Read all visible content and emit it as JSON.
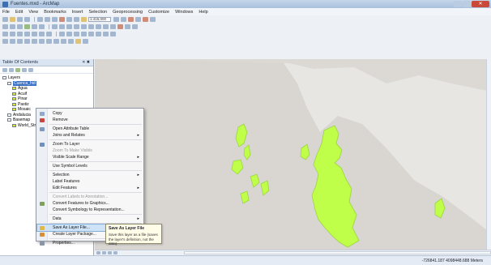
{
  "window": {
    "title": "Fuentes.mxd - ArcMap"
  },
  "menu": [
    "File",
    "Edit",
    "View",
    "Bookmarks",
    "Insert",
    "Selection",
    "Geoprocessing",
    "Customize",
    "Windows",
    "Help"
  ],
  "toolbar": {
    "scale": "1:415,000"
  },
  "toc": {
    "title": "Table Of Contents",
    "pin": "✕ ✖",
    "items": [
      {
        "label": "Layers",
        "indent": 0
      },
      {
        "label": "Cuenca_hid",
        "indent": 1,
        "selected": true
      },
      {
        "label": "Agua",
        "indent": 2
      },
      {
        "label": "Acuif",
        "indent": 2
      },
      {
        "label": "Pinar",
        "indent": 2
      },
      {
        "label": "Pastiz",
        "indent": 2
      },
      {
        "label": "Mosaic",
        "indent": 2
      },
      {
        "label": "Andalucia",
        "indent": 1
      },
      {
        "label": "Basemap",
        "indent": 1
      },
      {
        "label": "World_Stre",
        "indent": 2
      }
    ]
  },
  "context_menu": {
    "items": [
      {
        "label": "Copy",
        "icon_color": "#8fa7c9"
      },
      {
        "label": "Remove",
        "icon_color": "#c9473e"
      },
      {
        "sep": true
      },
      {
        "label": "Open Attribute Table",
        "icon_color": "#7e99bd"
      },
      {
        "label": "Joins and Relates",
        "arrow": true
      },
      {
        "sep": true
      },
      {
        "label": "Zoom To Layer",
        "icon_color": "#6f8fbf"
      },
      {
        "label": "Zoom To Make Visible",
        "disabled": true
      },
      {
        "label": "Visible Scale Range",
        "arrow": true
      },
      {
        "sep": true
      },
      {
        "label": "Use Symbol Levels"
      },
      {
        "sep": true
      },
      {
        "label": "Selection",
        "arrow": true
      },
      {
        "label": "Label Features"
      },
      {
        "label": "Edit Features",
        "arrow": true
      },
      {
        "sep": true
      },
      {
        "label": "Convert Labels to Annotation...",
        "disabled": true
      },
      {
        "label": "Convert Features to Graphics...",
        "icon_color": "#7ea15e"
      },
      {
        "label": "Convert Symbology to Representation..."
      },
      {
        "sep": true
      },
      {
        "label": "Data",
        "arrow": true
      },
      {
        "sep": true
      },
      {
        "label": "Save As Layer File...",
        "icon_color": "#e0b84a",
        "hover": true
      },
      {
        "label": "Create Layer Package...",
        "icon_color": "#d7903a"
      },
      {
        "sep": true
      },
      {
        "label": "Properties...",
        "icon_color": "#8a95a8"
      }
    ]
  },
  "tooltip": {
    "title": "Save As Layer File",
    "body": "Save this layer as a file (saves the layer's definition, not the data)."
  },
  "status": {
    "coordinates": "-726841.187 4098448.688 Meters"
  },
  "colors": {
    "land": "#bfff4a",
    "sea": "#e8e6e3",
    "land_outline": "#9bd63a",
    "highlight": "#3b6fc2"
  }
}
